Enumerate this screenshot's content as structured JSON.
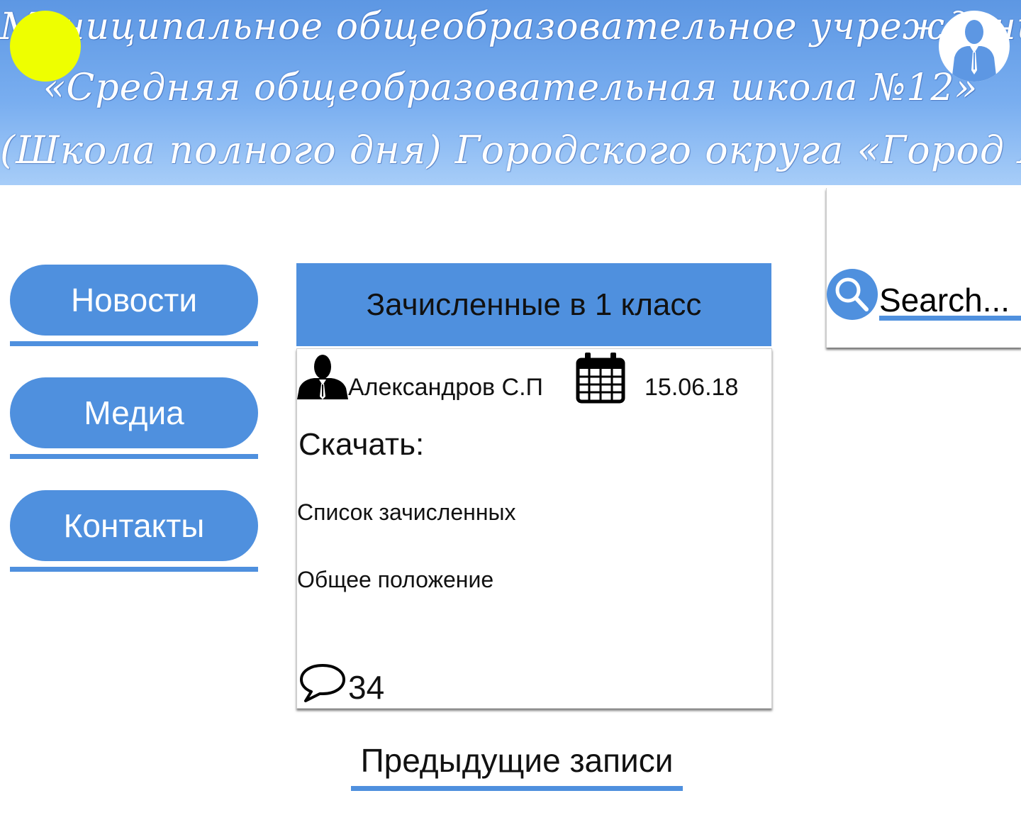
{
  "header": {
    "banner_lines": [
      "Муниципальное общеобразовательное учреждение",
      "«Средняя общеобразовательная школа №12»",
      "(Школа полного дня) Городского округа «Город Якутск»"
    ]
  },
  "nav": {
    "items": [
      {
        "label": "Новости"
      },
      {
        "label": "Медиа"
      },
      {
        "label": "Контакты"
      }
    ]
  },
  "search": {
    "placeholder": "Search..."
  },
  "post": {
    "title": "Зачисленные в 1 класс",
    "author": "Александров С.П",
    "date": "15.06.18",
    "download_label": "Скачать:",
    "files": [
      "Список зачисленных",
      "Общее положение"
    ],
    "comments_count": "34"
  },
  "pagination": {
    "previous_label": "Предыдущие записи"
  },
  "colors": {
    "accent": "#4f90de",
    "sun": "#eeff00",
    "banner_top": "#5d97e3",
    "banner_bottom": "#a7cdf8"
  },
  "icons": {
    "author": "person-silhouette-icon",
    "date": "calendar-icon",
    "comments": "speech-bubble-icon",
    "search": "magnifier-icon",
    "profile": "user-avatar-icon"
  }
}
